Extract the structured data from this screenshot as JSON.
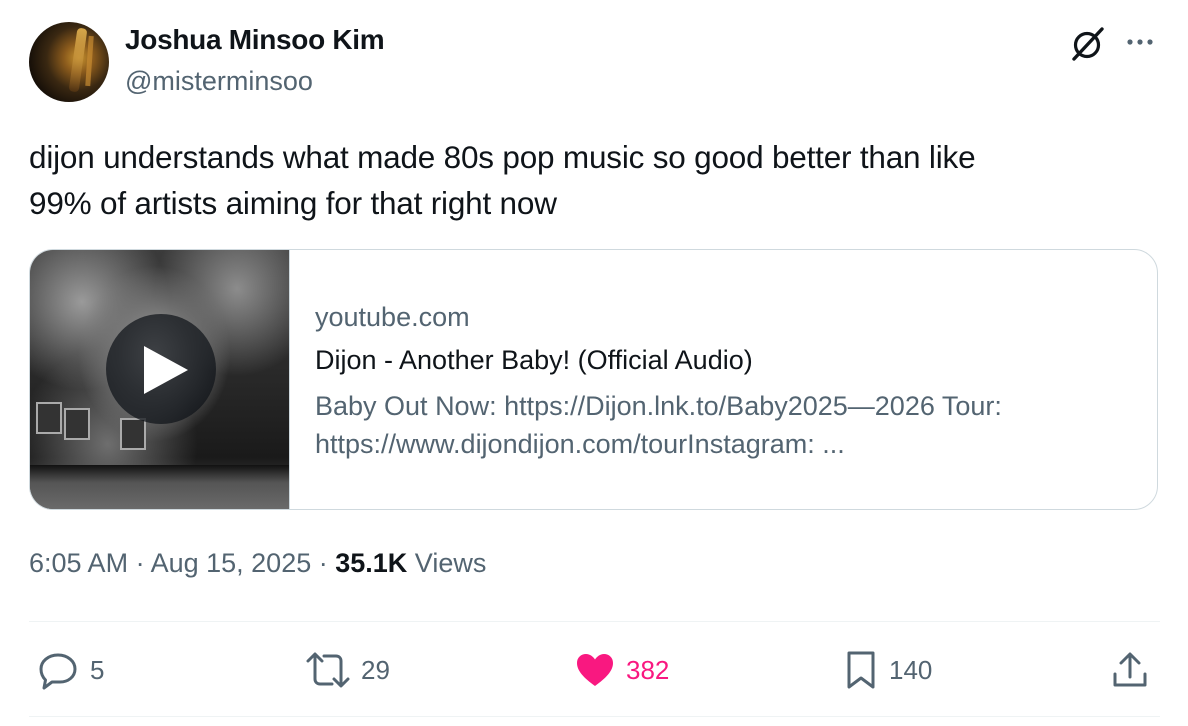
{
  "user": {
    "name": "Joshua Minsoo Kim",
    "handle": "@misterminsoo"
  },
  "tweet": {
    "text_line1": "dijon understands what made 80s pop music so good better than like",
    "text_line2": "99% of artists aiming for that right now"
  },
  "card": {
    "domain": "youtube.com",
    "title": "Dijon - Another Baby! (Official Audio)",
    "desc_line1": "Baby Out Now: https://Dijon.lnk.to/Baby2025—2026 Tour:",
    "desc_line2": "https://www.dijondijon.com/tourInstagram: ..."
  },
  "meta": {
    "time": "6:05 AM",
    "sep1": " · ",
    "date": "Aug 15, 2025",
    "sep2": " · ",
    "views_count": "35.1K",
    "views_label": " Views"
  },
  "actions": {
    "replies": "5",
    "reposts": "29",
    "likes": "382",
    "bookmarks": "140"
  },
  "icons": {
    "grok": "grok-icon",
    "more": "more-icon",
    "reply": "reply-icon",
    "repost": "repost-icon",
    "like": "heart-icon",
    "bookmark": "bookmark-icon",
    "share": "share-icon",
    "play": "play-icon"
  },
  "colors": {
    "text": "#0f1419",
    "secondary": "#536471",
    "like": "#f91880",
    "border": "#cfd9de"
  }
}
